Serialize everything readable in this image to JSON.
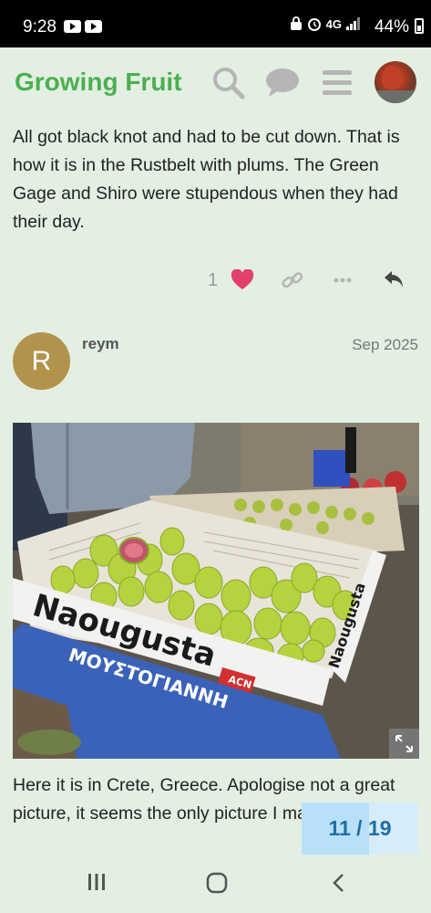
{
  "status_bar": {
    "time": "9:28",
    "network": "4G",
    "battery": "44%"
  },
  "header": {
    "site_title": "Growing Fruit",
    "icons": [
      "search-icon",
      "chat-icon",
      "hamburger-menu-icon",
      "user-avatar"
    ]
  },
  "post1": {
    "text": "All got black knot and had to be cut down. That is how it is in the Rustbelt with plums. The Green Gage and Shiro were stupendous when they had their day.",
    "like_count": "1",
    "action_icons": [
      "heart-icon",
      "link-icon",
      "more-icon",
      "reply-icon"
    ]
  },
  "post2": {
    "avatar_letter": "R",
    "username": "reym",
    "date": "Sep 2025",
    "image_box_text": {
      "brand": "Naougusta",
      "side_brand": "Naougusta",
      "supplier": "ΜΟΥΣΤΟΓΙΑΝΝΗ",
      "badge": "ACN"
    },
    "text": "Here it is in Crete, Greece. Apologise not a great picture, it seems the only picture I market."
  },
  "progress": {
    "label": "11 / 19",
    "current": 11,
    "total": 19
  },
  "colors": {
    "background": "#e3efe3",
    "brand": "#4caf50",
    "heart": "#e0406a",
    "progress_text": "#1f6fa5"
  }
}
